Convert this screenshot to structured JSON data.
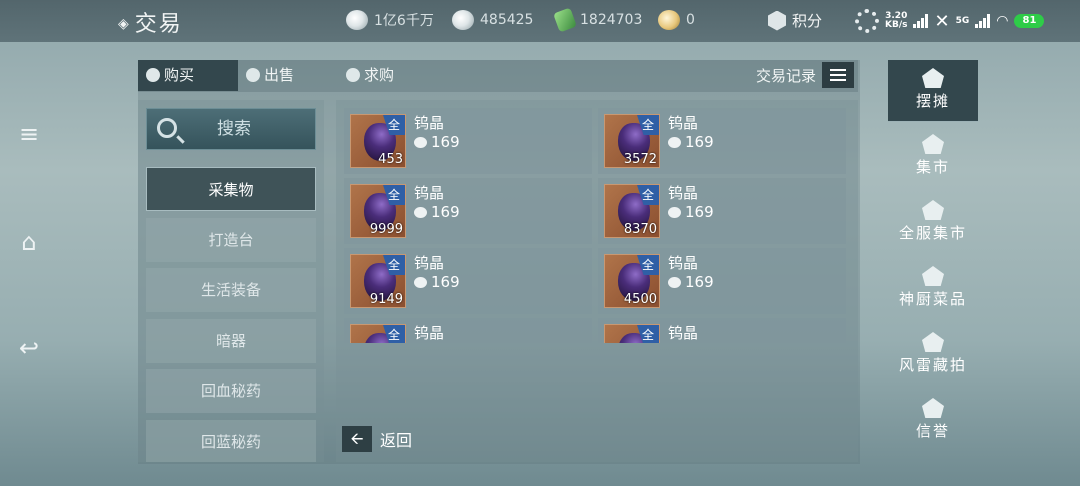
{
  "header": {
    "title": "交易",
    "currencies": [
      {
        "icon": "coin-icon",
        "value": "1亿6千万"
      },
      {
        "icon": "silver-ingot-icon",
        "value": "485425"
      },
      {
        "icon": "jade-icon",
        "value": "1824703"
      },
      {
        "icon": "gold-ingot-icon",
        "value": "0"
      }
    ],
    "score_label": "积分"
  },
  "status_bar": {
    "speed": "3.20",
    "speed_unit": "KB/s",
    "network": "5G",
    "battery": "81"
  },
  "tabs": [
    {
      "label": "购买",
      "active": true
    },
    {
      "label": "出售",
      "active": false
    },
    {
      "label": "求购",
      "active": false
    }
  ],
  "records_label": "交易记录",
  "search_label": "搜索",
  "categories": [
    {
      "label": "采集物",
      "active": true
    },
    {
      "label": "打造台"
    },
    {
      "label": "生活装备"
    },
    {
      "label": "暗器"
    },
    {
      "label": "回血秘药"
    },
    {
      "label": "回蓝秘药"
    }
  ],
  "items": [
    {
      "name": "钨晶",
      "qty": "453",
      "price": "169",
      "tag": "全"
    },
    {
      "name": "钨晶",
      "qty": "3572",
      "price": "169",
      "tag": "全"
    },
    {
      "name": "钨晶",
      "qty": "9999",
      "price": "169",
      "tag": "全"
    },
    {
      "name": "钨晶",
      "qty": "8370",
      "price": "169",
      "tag": "全"
    },
    {
      "name": "钨晶",
      "qty": "9149",
      "price": "169",
      "tag": "全"
    },
    {
      "name": "钨晶",
      "qty": "4500",
      "price": "169",
      "tag": "全"
    },
    {
      "name": "钨晶",
      "qty": "",
      "price": "",
      "tag": "全"
    },
    {
      "name": "钨晶",
      "qty": "",
      "price": "",
      "tag": "全"
    }
  ],
  "back_label": "返回",
  "right_nav": [
    {
      "label": "摆摊",
      "active": true
    },
    {
      "label": "集市"
    },
    {
      "label": "全服集市"
    },
    {
      "label": "神厨菜品"
    },
    {
      "label": "风雷藏拍"
    },
    {
      "label": "信誉"
    }
  ]
}
